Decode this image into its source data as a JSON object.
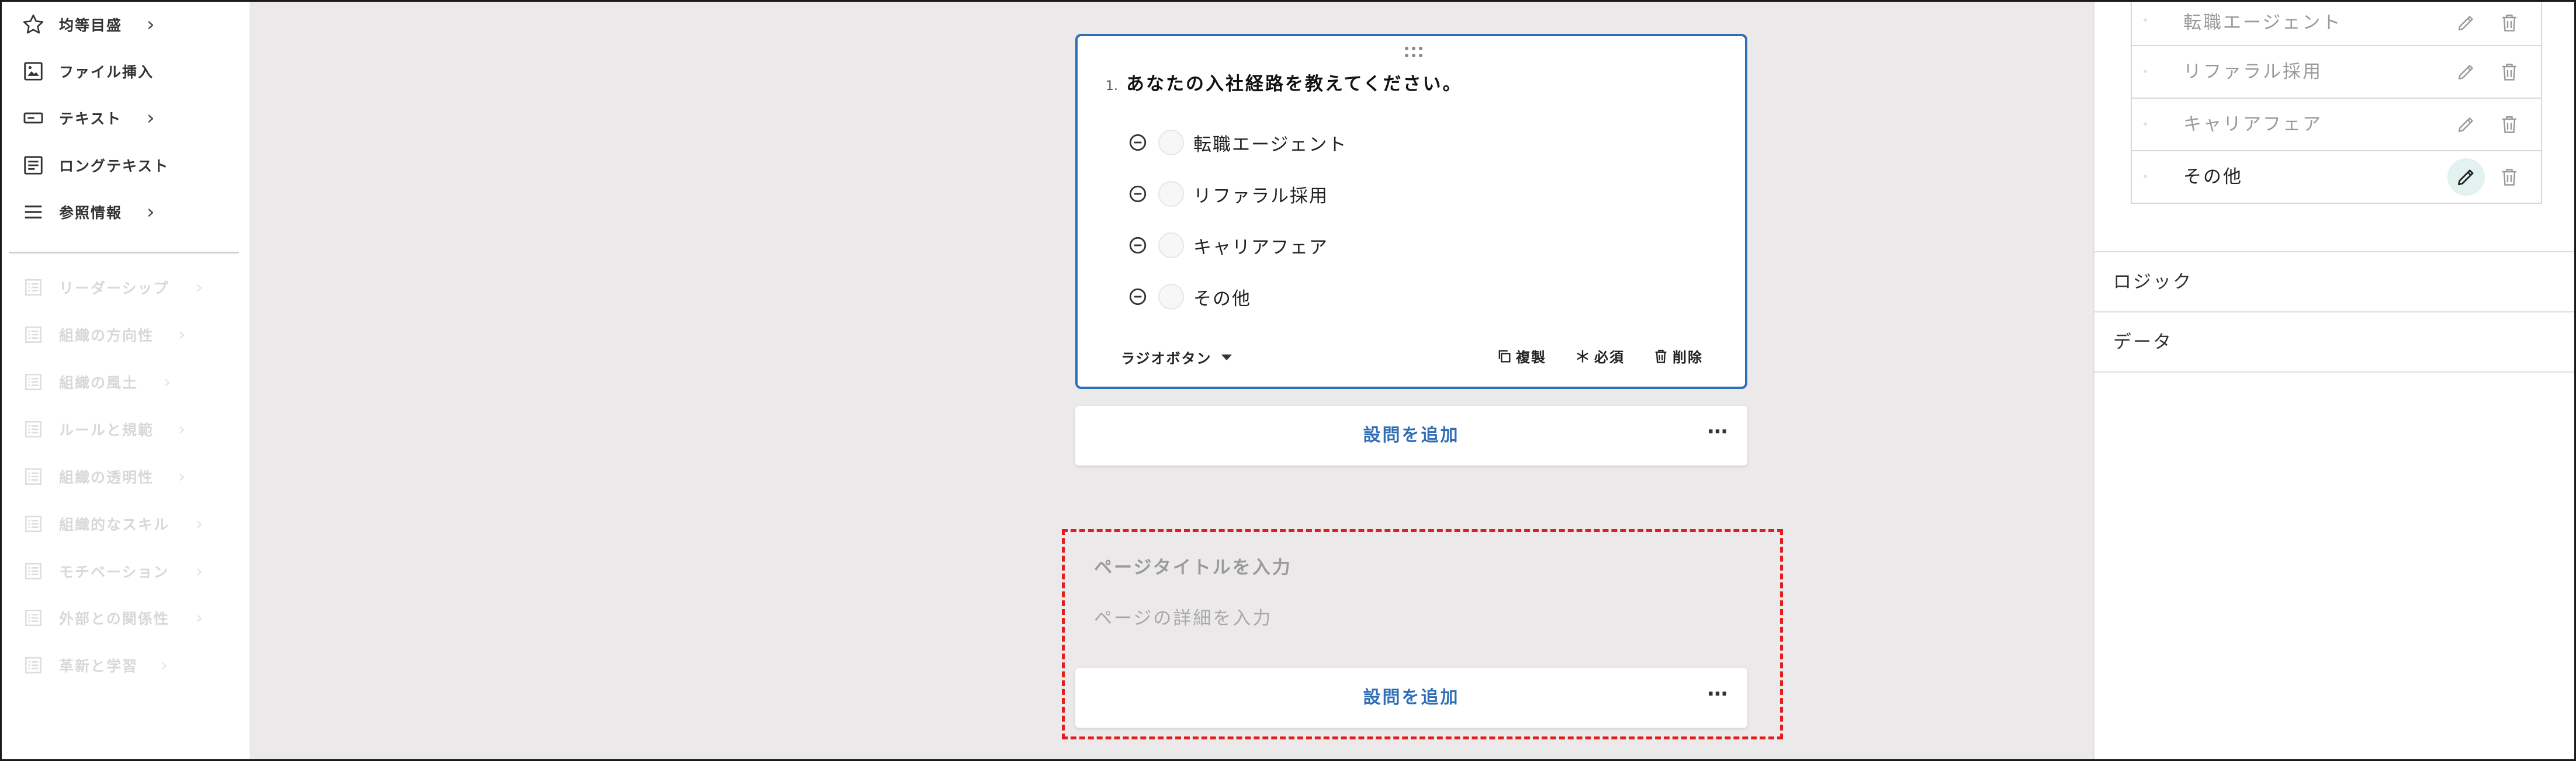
{
  "sidebar": {
    "items": [
      {
        "label": "均等目盛"
      },
      {
        "label": "ファイル挿入"
      },
      {
        "label": "テキスト"
      },
      {
        "label": "ロングテキスト"
      },
      {
        "label": "参照情報"
      }
    ],
    "templates": [
      {
        "label": "リーダーシップ"
      },
      {
        "label": "組織の方向性"
      },
      {
        "label": "組織の風土"
      },
      {
        "label": "ルールと規範"
      },
      {
        "label": "組織の透明性"
      },
      {
        "label": "組織的なスキル"
      },
      {
        "label": "モチベーション"
      },
      {
        "label": "外部との関係性"
      },
      {
        "label": "革新と学習"
      }
    ]
  },
  "question": {
    "number": "1.",
    "text": "あなたの入社経路を教えてください。",
    "options": [
      {
        "label": "転職エージェント"
      },
      {
        "label": "リファラル採用"
      },
      {
        "label": "キャリアフェア"
      },
      {
        "label": "その他"
      }
    ],
    "type_label": "ラジオボタン",
    "actions": {
      "duplicate": "複製",
      "required": "必須",
      "delete": "削除"
    }
  },
  "add_question": {
    "label": "設問を追加",
    "more": "···"
  },
  "new_page": {
    "title_placeholder": "ページタイトルを入力",
    "description_placeholder": "ページの詳細を入力",
    "add_label": "設問を追加",
    "more": "···"
  },
  "right_panel": {
    "options": [
      {
        "label": "転職エージェント"
      },
      {
        "label": "リファラル採用"
      },
      {
        "label": "キャリアフェア"
      },
      {
        "label": "その他"
      }
    ],
    "sections": [
      {
        "label": "ロジック"
      },
      {
        "label": "データ"
      }
    ]
  },
  "colors": {
    "accent": "#2f6db5",
    "highlight": "#e01e1e",
    "canvas": "#ece9ea",
    "edit_active": "#e3f2ee"
  }
}
